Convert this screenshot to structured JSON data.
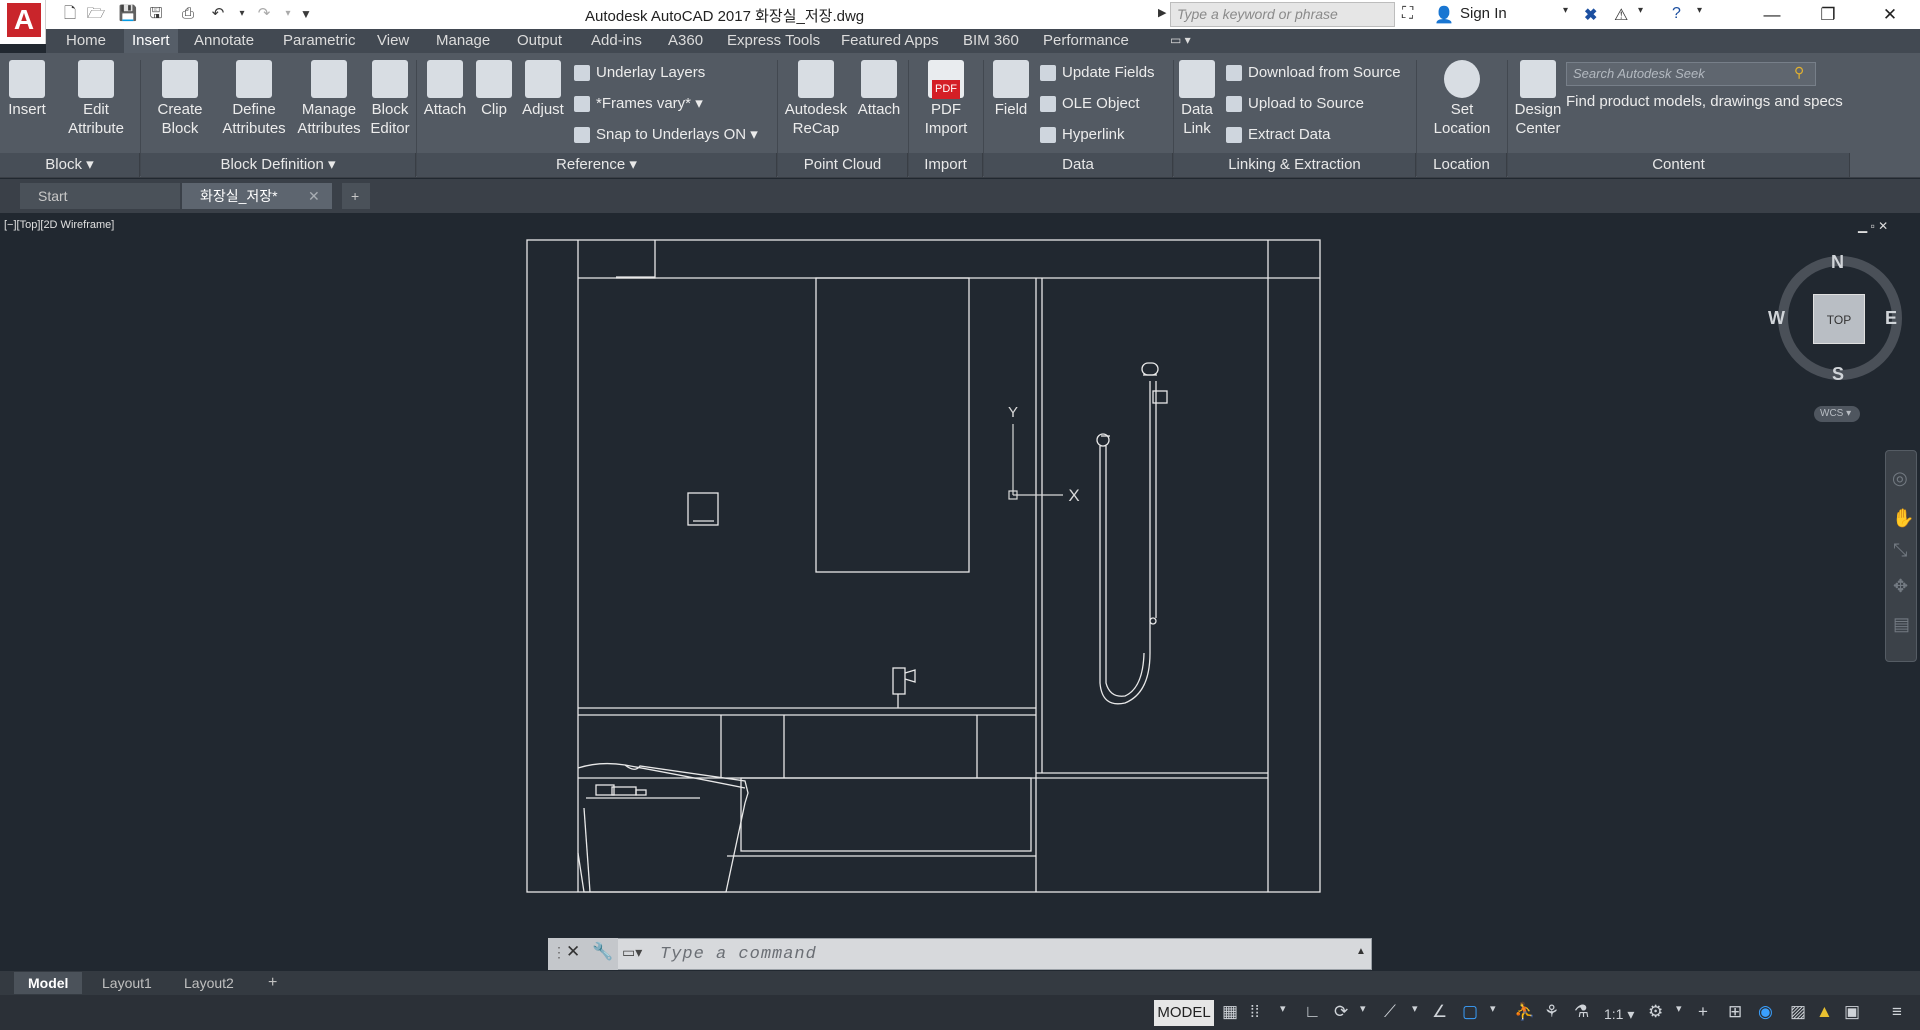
{
  "window": {
    "title": "Autodesk AutoCAD 2017    화장실_저장.dwg",
    "search_placeholder": "Type a keyword or phrase",
    "sign_in": "Sign In",
    "minimize": "—",
    "restore": "❐",
    "close": "✕"
  },
  "ribbon_tabs": [
    "Home",
    "Insert",
    "Annotate",
    "Parametric",
    "View",
    "Manage",
    "Output",
    "Add-ins",
    "A360",
    "Express Tools",
    "Featured Apps",
    "BIM 360",
    "Performance"
  ],
  "active_tab": "Insert",
  "panels": {
    "block": {
      "title": "Block",
      "insert": "Insert",
      "edit_attr_1": "Edit",
      "edit_attr_2": "Attribute"
    },
    "block_def": {
      "title": "Block Definition",
      "create_1": "Create",
      "create_2": "Block",
      "define_1": "Define",
      "define_2": "Attributes",
      "manage_1": "Manage",
      "manage_2": "Attributes",
      "editor_1": "Block",
      "editor_2": "Editor"
    },
    "reference": {
      "title": "Reference",
      "attach": "Attach",
      "clip": "Clip",
      "adjust": "Adjust",
      "underlay_layers": "Underlay Layers",
      "frames_vary": "*Frames vary*",
      "snap_underlays": "Snap to Underlays ON"
    },
    "point_cloud": {
      "title": "Point Cloud",
      "recap_1": "Autodesk",
      "recap_2": "ReCap",
      "attach": "Attach"
    },
    "import": {
      "title": "Import",
      "pdf_1": "PDF",
      "pdf_2": "Import",
      "pdf_badge": "PDF"
    },
    "data": {
      "title": "Data",
      "field": "Field",
      "update_fields": "Update Fields",
      "ole_object": "OLE Object",
      "hyperlink": "Hyperlink"
    },
    "linking": {
      "title": "Linking & Extraction",
      "data_link_1": "Data",
      "data_link_2": "Link",
      "download": "Download from Source",
      "upload": "Upload to Source",
      "extract": "Extract  Data"
    },
    "location": {
      "title": "Location",
      "set_1": "Set",
      "set_2": "Location"
    },
    "content": {
      "title": "Content",
      "design_1": "Design",
      "design_2": "Center",
      "seek_placeholder": "Search Autodesk Seek",
      "seek_desc": "Find product models, drawings and specs"
    }
  },
  "doc_tabs": {
    "start": "Start",
    "current": "화장실_저장*"
  },
  "viewport": {
    "label": "[−][Top][2D Wireframe]",
    "ucs_y": "Y",
    "ucs_x": "X"
  },
  "viewcube": {
    "n": "N",
    "s": "S",
    "e": "E",
    "w": "W",
    "top": "TOP",
    "wcs": "WCS"
  },
  "command": {
    "placeholder": "Type  a  command"
  },
  "layout_tabs": [
    "Model",
    "Layout1",
    "Layout2"
  ],
  "status": {
    "model": "MODEL",
    "scale": "1:1"
  },
  "colors": {
    "accent": "#c9252b",
    "viewport_bg": "#212830",
    "ribbon_bg": "#535a63"
  }
}
